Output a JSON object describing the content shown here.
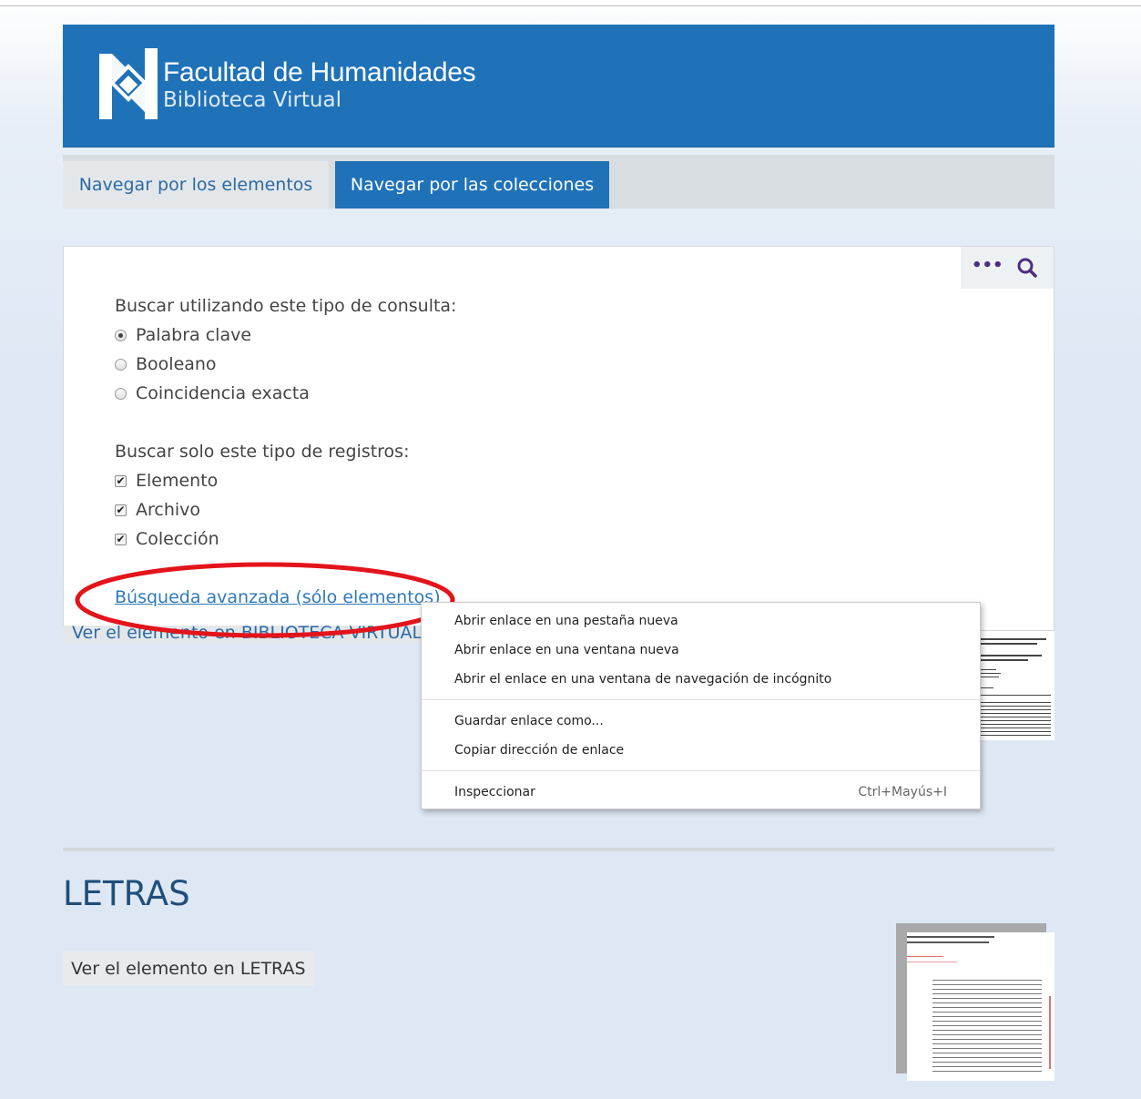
{
  "header": {
    "title": "Facultad de Humanidades",
    "subtitle": "Biblioteca Virtual"
  },
  "nav": {
    "tabs": [
      {
        "label": "Navegar por los elementos",
        "active": false
      },
      {
        "label": "Navegar por las colecciones",
        "active": true
      }
    ]
  },
  "search": {
    "value": "",
    "placeholder": "",
    "more_icon": "ellipsis-icon",
    "search_icon": "search-icon",
    "query_type_label": "Buscar utilizando este tipo de consulta:",
    "query_types": [
      {
        "label": "Palabra clave",
        "selected": true
      },
      {
        "label": "Booleano",
        "selected": false
      },
      {
        "label": "Coincidencia exacta",
        "selected": false
      }
    ],
    "record_type_label": "Buscar solo este tipo de registros:",
    "record_types": [
      {
        "label": "Elemento",
        "checked": true
      },
      {
        "label": "Archivo",
        "checked": true
      },
      {
        "label": "Colección",
        "checked": true
      }
    ],
    "advanced_link": "Búsqueda avanzada (sólo elementos)"
  },
  "behind_link_text": "Ver el elemento en BIBLIOTECA VIRTUAL",
  "context_menu": {
    "items": [
      {
        "label": "Abrir enlace en una pestaña nueva"
      },
      {
        "label": "Abrir enlace en una ventana nueva"
      },
      {
        "label": "Abrir el enlace en una ventana de navegación de incógnito"
      },
      {
        "label": "Guardar enlace como..."
      },
      {
        "label": "Copiar dirección de enlace"
      },
      {
        "label": "Inspeccionar",
        "shortcut": "Ctrl+Mayús+I"
      }
    ]
  },
  "annotation": {
    "color": "#e3141b"
  },
  "collection": {
    "title": "LETRAS",
    "link": "Ver el elemento en LETRAS"
  },
  "colors": {
    "brand": "#1f72b8",
    "link": "#2f7ab9",
    "title": "#1f4e7a"
  }
}
